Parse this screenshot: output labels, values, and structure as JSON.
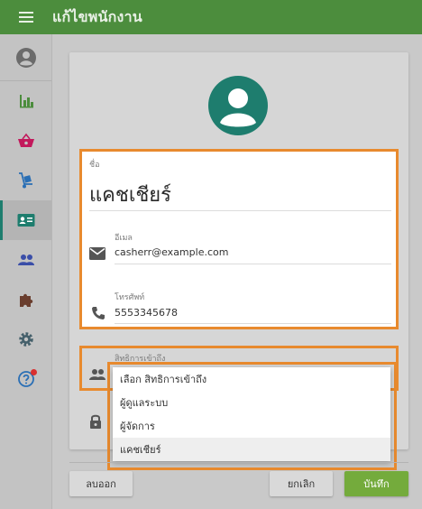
{
  "appbar": {
    "title": "แก้ไขพนักงาน",
    "menu_icon": "hamburger-menu-icon",
    "color": "#4c8d3d"
  },
  "sidebar": {
    "items": [
      {
        "name": "account-circle-icon"
      },
      {
        "name": "bar-chart-icon"
      },
      {
        "name": "basket-icon"
      },
      {
        "name": "hand-truck-icon"
      },
      {
        "name": "badge-card-icon",
        "active": true
      },
      {
        "name": "people-icon"
      },
      {
        "name": "puzzle-piece-icon"
      },
      {
        "name": "gear-icon"
      },
      {
        "name": "help-icon"
      }
    ],
    "active_color": "#1e7d6e"
  },
  "form": {
    "name_label": "ชื่อ",
    "name_value": "แคชเชียร์",
    "email_label": "อีเมล",
    "email_value": "casherr@example.com",
    "phone_label": "โทรศัพท์",
    "phone_value": "5553345678",
    "role_label": "สิทธิการเข้าถึง"
  },
  "dropdown": {
    "options": [
      "เลือก สิทธิการเข้าถึง",
      "ผู้ดูแลระบบ",
      "ผู้จัดการ",
      "แคชเชียร์"
    ],
    "selected": "แคชเชียร์"
  },
  "footer": {
    "delete_label": "ลบออก",
    "cancel_label": "ยกเลิก",
    "save_label": "บันทึก"
  },
  "colors": {
    "highlight": "#e88a2e",
    "save_button": "#74ab3c",
    "avatar": "#1e7d6e"
  }
}
